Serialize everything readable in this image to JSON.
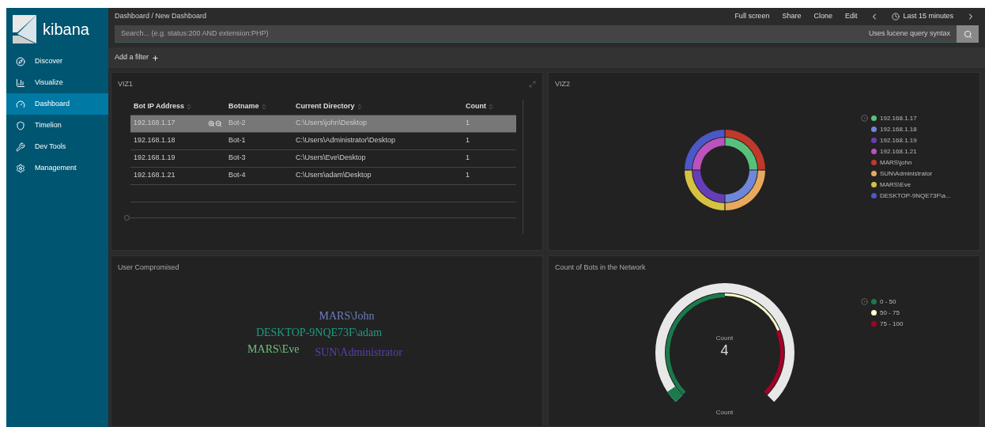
{
  "sidebar": {
    "logo": "kibana",
    "items": [
      {
        "label": "Discover",
        "selected": false
      },
      {
        "label": "Visualize",
        "selected": false
      },
      {
        "label": "Dashboard",
        "selected": true
      },
      {
        "label": "Timelion",
        "selected": false
      },
      {
        "label": "Dev Tools",
        "selected": false
      },
      {
        "label": "Management",
        "selected": false
      }
    ]
  },
  "breadcrumb": "Dashboard / New Dashboard",
  "top_actions": [
    "Full screen",
    "Share",
    "Clone",
    "Edit"
  ],
  "time_range": "Last 15 minutes",
  "search": {
    "placeholder": "Search... (e.g. status:200 AND extension:PHP)",
    "hint": "Uses lucene query syntax"
  },
  "add_filter": "Add a filter",
  "table_panel": {
    "title": "VIZ1",
    "columns": [
      "Bot IP Address",
      "Botname",
      "Current Directory",
      "Count"
    ],
    "rows": [
      {
        "cells": [
          "192.168.1.17",
          "Bot-2",
          "C:\\Users\\john\\Desktop",
          "1"
        ],
        "selected": true
      },
      {
        "cells": [
          "192.168.1.18",
          "Bot-1",
          "C:\\Users\\Administrator\\Desktop",
          "1"
        ],
        "selected": false
      },
      {
        "cells": [
          "192.168.1.19",
          "Bot-3",
          "C:\\Users\\Eve\\Desktop",
          "1"
        ],
        "selected": false
      },
      {
        "cells": [
          "192.168.1.21",
          "Bot-4",
          "C:\\Users\\adam\\Desktop",
          "1"
        ],
        "selected": false
      }
    ]
  },
  "donut_panel": {
    "title": "VIZ2",
    "legend": [
      {
        "label": "192.168.1.17",
        "color": "#57c17b"
      },
      {
        "label": "192.168.1.18",
        "color": "#6f87d8"
      },
      {
        "label": "192.168.1.19",
        "color": "#663db8"
      },
      {
        "label": "192.168.1.21",
        "color": "#bc52bc"
      },
      {
        "label": "MARS\\john",
        "color": "#c0392b"
      },
      {
        "label": "SUN\\Administrator",
        "color": "#e8a95c"
      },
      {
        "label": "MARS\\Eve",
        "color": "#d6c143"
      },
      {
        "label": "DESKTOP-9NQE73F\\a...",
        "color": "#4a58c8"
      }
    ]
  },
  "cloud_panel": {
    "title": "User Compromised",
    "words": [
      {
        "text": "MARS\\John",
        "color": "#6d7fc0"
      },
      {
        "text": "DESKTOP-9NQE73F\\adam",
        "color": "#1f9c84"
      },
      {
        "text": "MARS\\Eve",
        "color": "#6fc07a"
      },
      {
        "text": "SUN\\Administrator",
        "color": "#5a3fb0"
      }
    ]
  },
  "gauge_panel": {
    "title": "Count of Bots in the Network",
    "label": "Count",
    "value": "4",
    "footer": "Count",
    "legend": [
      {
        "label": "0 - 50",
        "color": "#1a7a4c"
      },
      {
        "label": "50 - 75",
        "color": "#ffffcc"
      },
      {
        "label": "75 - 100",
        "color": "#a50026"
      }
    ]
  }
}
